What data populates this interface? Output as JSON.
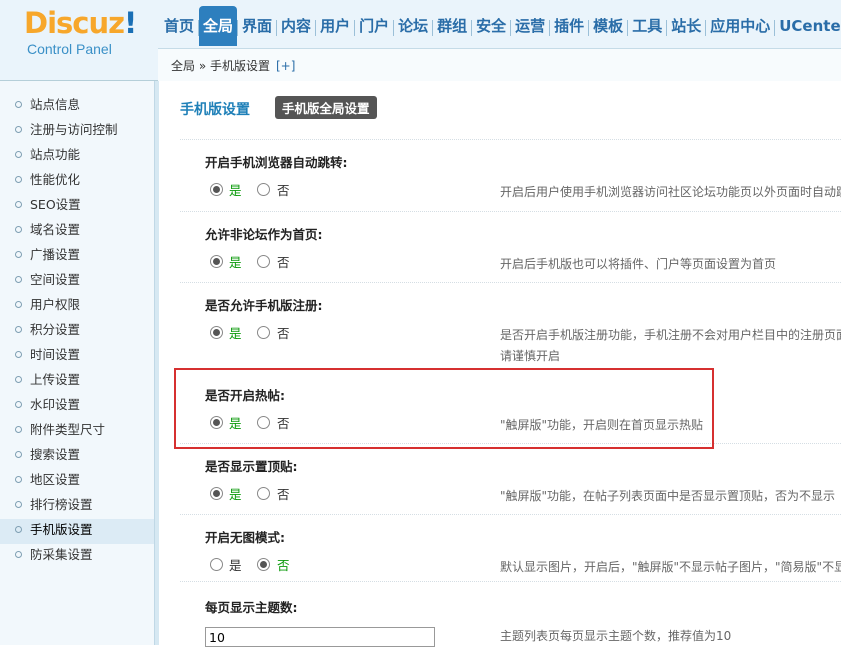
{
  "logo": {
    "brand": "Discuz",
    "bang": "!",
    "sub": "Control Panel"
  },
  "nav": [
    "首页",
    "全局",
    "界面",
    "内容",
    "用户",
    "门户",
    "论坛",
    "群组",
    "安全",
    "运营",
    "插件",
    "模板",
    "工具",
    "站长",
    "应用中心",
    "UCenter"
  ],
  "nav_active": "全局",
  "breadcrumb": {
    "path": "全局 » 手机版设置",
    "plus": "[+]"
  },
  "sidebar": {
    "items": [
      "站点信息",
      "注册与访问控制",
      "站点功能",
      "性能优化",
      "SEO设置",
      "域名设置",
      "广播设置",
      "空间设置",
      "用户权限",
      "积分设置",
      "时间设置",
      "上传设置",
      "水印设置",
      "附件类型尺寸",
      "搜索设置",
      "地区设置",
      "排行榜设置",
      "手机版设置",
      "防采集设置"
    ],
    "active": "手机版设置"
  },
  "main": {
    "title": "手机版设置",
    "tab": "手机版全局设置",
    "yes": "是",
    "no": "否",
    "settings": [
      {
        "title": "开启手机浏览器自动跳转:",
        "value": "yes",
        "desc": [
          "开启后用户使用手机浏览器访问社区论坛功能页以外页面时自动跳"
        ]
      },
      {
        "title": "允许非论坛作为首页:",
        "value": "yes",
        "desc": [
          "开启后手机版也可以将插件、门户等页面设置为首页"
        ]
      },
      {
        "title": "是否允许手机版注册:",
        "value": "yes",
        "desc": [
          "是否开启手机版注册功能，手机注册不会对用户栏目中的注册页面",
          "请谨慎开启"
        ]
      },
      {
        "title": "是否开启热帖:",
        "value": "yes",
        "desc": [
          "\"触屏版\"功能，开启则在首页显示热贴"
        ]
      },
      {
        "title": "是否显示置顶贴:",
        "value": "yes",
        "desc": [
          "\"触屏版\"功能，在帖子列表页面中是否显示置顶贴，否为不显示"
        ]
      },
      {
        "title": "开启无图模式:",
        "value": "no",
        "desc": [
          "默认显示图片，开启后，\"触屏版\"不显示帖子图片，\"简易版\"不显"
        ]
      }
    ],
    "topics": {
      "title": "每页显示主题数:",
      "value": "10",
      "desc": "主题列表页每页显示主题个数，推荐值为10"
    }
  }
}
